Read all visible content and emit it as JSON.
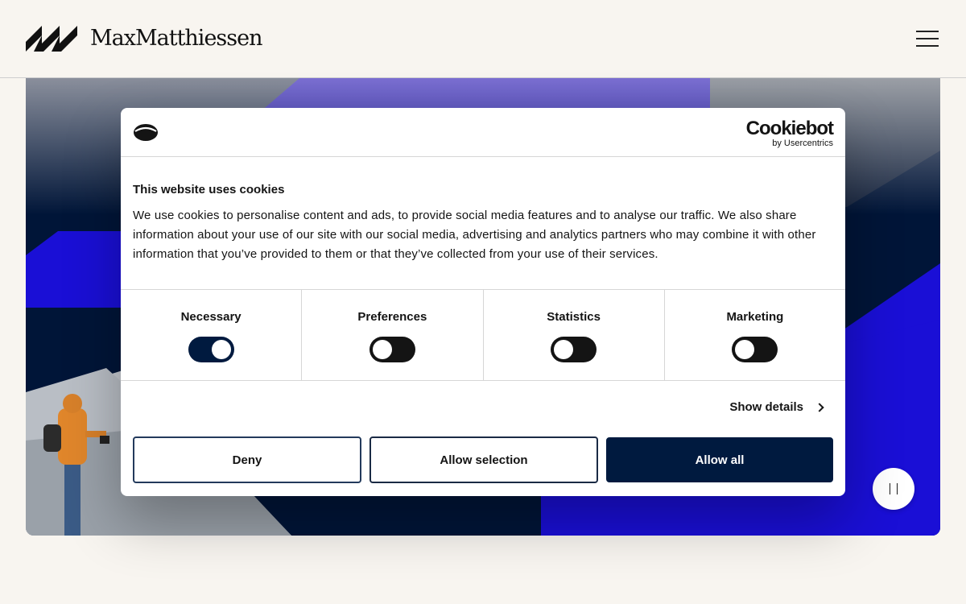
{
  "header": {
    "brand_name": "MaxMatthiessen"
  },
  "cookie_dialog": {
    "vendor_name": "Cookiebot",
    "vendor_sub": "by Usercentrics",
    "title": "This website uses cookies",
    "description": "We use cookies to personalise content and ads, to provide social media features and to analyse our traffic. We also share information about your use of our site with our social media, advertising and analytics partners who may combine it with other information that you’ve provided to them or that they’ve collected from your use of their services.",
    "categories": [
      {
        "label": "Necessary",
        "enabled": true
      },
      {
        "label": "Preferences",
        "enabled": false
      },
      {
        "label": "Statistics",
        "enabled": false
      },
      {
        "label": "Marketing",
        "enabled": false
      }
    ],
    "show_details_label": "Show details",
    "deny_label": "Deny",
    "allow_selection_label": "Allow selection",
    "allow_all_label": "Allow all"
  },
  "colors": {
    "page_background": "#f8f5f0",
    "navy": "#001538",
    "primary_button": "#001a3f",
    "accent_blue": "#1a0fd6",
    "accent_purple": "#7a6fd0"
  },
  "icons": {
    "menu": "hamburger-icon",
    "pause": "pause-icon",
    "chevron": "chevron-right-icon",
    "cookie": "cookie-icon"
  }
}
